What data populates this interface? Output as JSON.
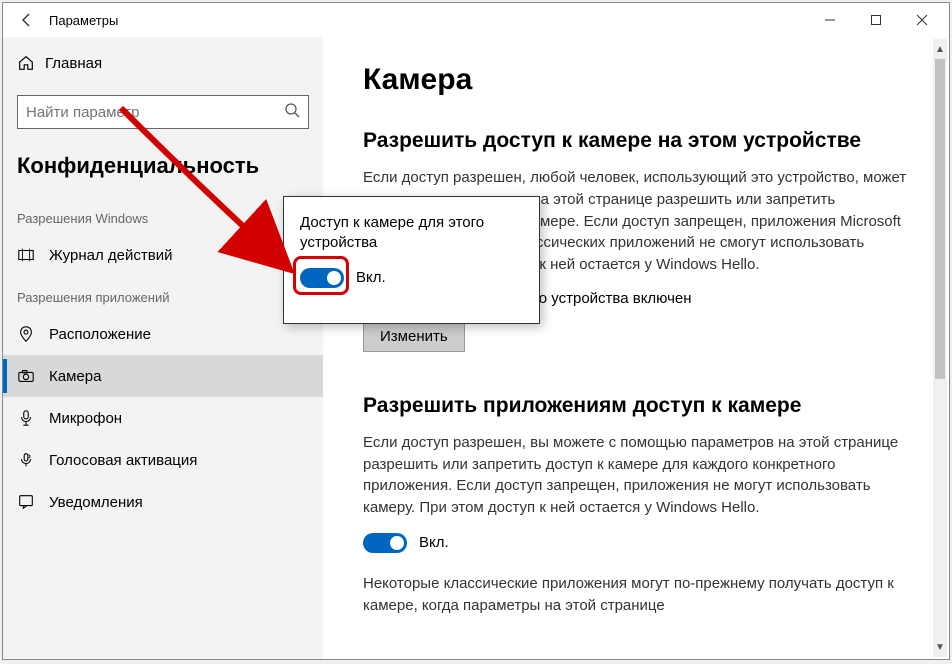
{
  "window": {
    "title": "Параметры"
  },
  "sidebar": {
    "home": "Главная",
    "search_placeholder": "Найти параметр",
    "section": "Конфиденциальность",
    "group_windows": "Разрешения Windows",
    "group_apps": "Разрешения приложений",
    "items_windows": [
      {
        "label": "Журнал действий"
      }
    ],
    "items_apps": [
      {
        "label": "Расположение"
      },
      {
        "label": "Камера"
      },
      {
        "label": "Микрофон"
      },
      {
        "label": "Голосовая активация"
      },
      {
        "label": "Уведомления"
      }
    ]
  },
  "content": {
    "page_title": "Камера",
    "section1": {
      "heading": "Разрешить доступ к камере на этом устройстве",
      "body": "Если доступ разрешен, любой человек, использующий это устройство, может с помощью параметров на этой странице разрешить или запретить приложениям доступ к камере. Если доступ запрещен, приложения Microsoft Store и большинство классических приложений не смогут использовать камеру. При этом доступ к ней остается у Windows Hello.",
      "status_prefix": "Доступ к камере для этого устройства включен",
      "change_button": "Изменить"
    },
    "section2": {
      "heading": "Разрешить приложениям доступ к камере",
      "body": "Если доступ разрешен, вы можете с помощью параметров на этой странице разрешить или запретить доступ к камере для каждого конкретного приложения. Если доступ запрещен, приложения не могут использовать камеру. При этом доступ к ней остается у Windows Hello.",
      "toggle_label": "Вкл.",
      "footnote": "Некоторые классические приложения могут по-прежнему получать доступ к камере, когда параметры на этой странице"
    }
  },
  "popup": {
    "title": "Доступ к камере для этого устройства",
    "toggle_label": "Вкл."
  }
}
